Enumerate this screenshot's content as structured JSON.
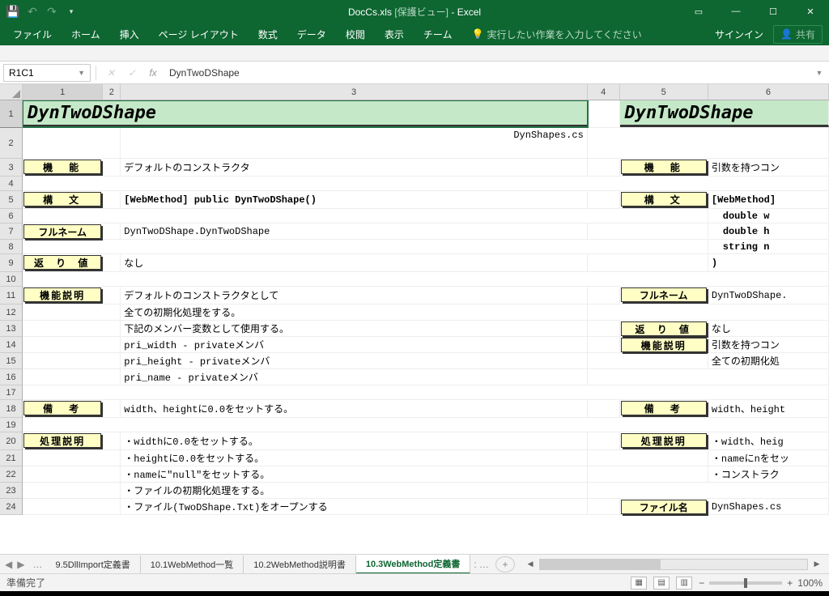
{
  "title": {
    "doc": "DocCs.xls",
    "mode": "[保護ビュー]",
    "app": "Excel"
  },
  "tabs": {
    "file": "ファイル",
    "home": "ホーム",
    "insert": "挿入",
    "layout": "ページ レイアウト",
    "formula": "数式",
    "data": "データ",
    "review": "校閲",
    "view": "表示",
    "team": "チーム",
    "tellme": "実行したい作業を入力してください"
  },
  "signin": "サインイン",
  "share": "共有",
  "nameBox": "R1C1",
  "fxValue": "DynTwoDShape",
  "cols": {
    "c1": "1",
    "c2": "2",
    "c3": "3",
    "c4": "4",
    "c5": "5",
    "c6": "6"
  },
  "rows": {
    "r1": "1",
    "r2": "2",
    "r3": "3",
    "r4": "4",
    "r5": "5",
    "r6": "6",
    "r7": "7",
    "r8": "8",
    "r9": "9",
    "r10": "10",
    "r11": "11",
    "r12": "12",
    "r13": "13",
    "r14": "14",
    "r15": "15",
    "r16": "16",
    "r17": "17",
    "r18": "18",
    "r19": "19",
    "r20": "20",
    "r21": "21",
    "r22": "22",
    "r23": "23",
    "r24": "24"
  },
  "cells": {
    "a1": "DynTwoDShape",
    "e1": "DynTwoDShape",
    "c2": "DynShapes.cs",
    "a3": "機　能",
    "c3": "デフォルトのコンストラクタ",
    "e3": "機　能",
    "f3": "引数を持つコン",
    "a5": "構　文",
    "c5": "[WebMethod] public DynTwoDShape()",
    "e5": "構　文",
    "f5": "[WebMethod]",
    "f6": "double w",
    "f7b": "double h",
    "a7": "フルネーム",
    "c7": "DynTwoDShape.DynTwoDShape",
    "f8": "string n",
    "a9": "返 り 値",
    "c9": "なし",
    "f9": ")",
    "e10": "フルネーム",
    "f10": "DynTwoDShape.",
    "a11": "機能説明",
    "c11": "デフォルトのコンストラクタとして",
    "c12": "全ての初期化処理をする。",
    "e12": "返 り 値",
    "f12": "なし",
    "c13": "下記のメンバー変数として使用する。",
    "c14": " pri_width - privateメンバ",
    "e14": "機能説明",
    "f14": "引数を持つコン",
    "c15": " pri_height - privateメンバ",
    "f15": "全ての初期化処",
    "c16": " pri_name - privateメンバ",
    "a18": "備　考",
    "c18": "width、heightに0.0をセットする。",
    "e18": "備　考",
    "f18": "width、height",
    "a20": "処理説明",
    "c20": "・widthに0.0をセットする。",
    "e20": "処理説明",
    "f20": "・width、heig",
    "c21": "・heightに0.0をセットする。",
    "f21": "・nameにnをセッ",
    "c22": "・nameに\"null\"をセットする。",
    "f22": "・コンストラク",
    "c23": "・ファイルの初期化処理をする。",
    "c24": "・ファイル(TwoDShape.Txt)をオープンする",
    "e24": "ファイル名",
    "f24": "DynShapes.cs"
  },
  "sheets": {
    "s1": "9.5DllImport定義書",
    "s2": "10.1WebMethod一覧",
    "s3": "10.2WebMethod説明書",
    "s4": "10.3WebMethod定義書"
  },
  "status": "準備完了",
  "zoom": "100%"
}
